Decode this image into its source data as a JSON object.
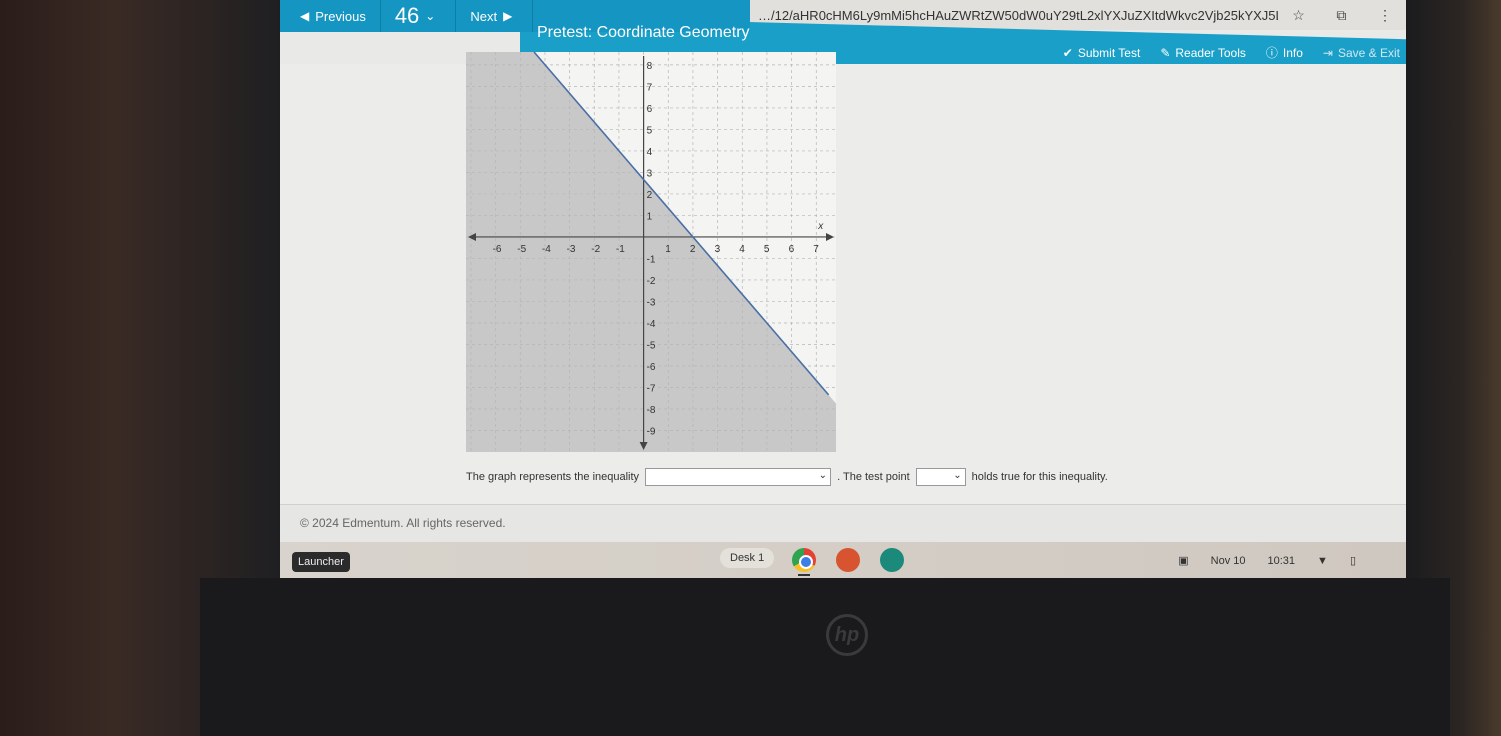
{
  "browser": {
    "url": "…/12/aHR0cHM6Ly9mMi5hcHAuZWRtZW50dW0uY29tL2xlYXJuZXItdWkvc2Vjb25kYXJ5L3VzZ…",
    "icons": [
      "star-icon",
      "extension-icon",
      "menu-icon"
    ]
  },
  "nav": {
    "previous_label": "Previous",
    "question_number": "46",
    "next_label": "Next",
    "title": "Pretest: Coordinate Geometry",
    "tools": [
      {
        "label": "Submit Test",
        "icon": "check-circle-icon"
      },
      {
        "label": "Reader Tools",
        "icon": "wrench-icon"
      },
      {
        "label": "Info",
        "icon": "info-icon"
      },
      {
        "label": "Save & Exit",
        "icon": "exit-icon"
      }
    ]
  },
  "graph": {
    "x_label": "x",
    "x_ticks": [
      "-6",
      "-5",
      "-4",
      "-3",
      "-2",
      "-1",
      "1",
      "2",
      "3",
      "4",
      "5",
      "6",
      "7"
    ],
    "y_ticks": [
      "8",
      "7",
      "6",
      "5",
      "4",
      "3",
      "2",
      "1",
      "-1",
      "-2",
      "-3",
      "-4",
      "-5",
      "-6",
      "-7",
      "-8",
      "-9"
    ],
    "boundary_points": [
      [
        0,
        2.67
      ],
      [
        2,
        0
      ]
    ],
    "shaded_region": "below-left",
    "line_style": "solid",
    "fill_color": "#c8c8c8",
    "line_color": "#4a6fa5"
  },
  "question": {
    "text_before": "The graph represents the inequality",
    "inequality_value": "",
    "text_middle": ". The test point",
    "test_point_value": "",
    "text_after": "holds true for this inequality."
  },
  "footer": {
    "copyright": "© 2024 Edmentum. All rights reserved."
  },
  "shelf": {
    "launcher_label": "Launcher",
    "desk_label": "Desk 1",
    "date": "Nov 10",
    "time": "10:31"
  }
}
